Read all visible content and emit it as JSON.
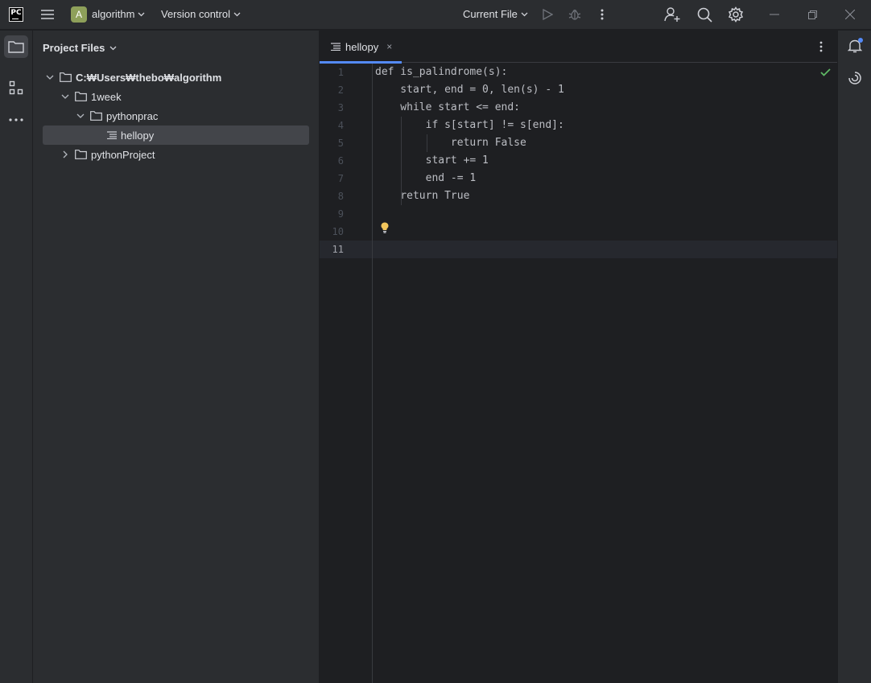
{
  "titlebar": {
    "app_logo_text": "PC",
    "main_menu_icon": "hamburger-icon",
    "project_initial": "A",
    "project_name": "algorithm",
    "vcs_label": "Version control",
    "run_config": "Current File",
    "icons": [
      "run-icon",
      "debug-icon",
      "more-vertical-icon",
      "add-user-icon",
      "search-icon",
      "gear-icon",
      "minimize-icon",
      "restore-icon",
      "close-icon"
    ]
  },
  "toolstrip": {
    "icons": [
      "folder-icon",
      "structure-icon",
      "more-horizontal-icon"
    ]
  },
  "project_panel": {
    "title": "Project Files",
    "tree": [
      {
        "label": "C:₩Users₩thebo₩algorithm",
        "expanded": true
      },
      {
        "label": "1week",
        "expanded": true
      },
      {
        "label": "pythonprac",
        "expanded": true
      },
      {
        "label": "hellopy",
        "selected": true
      },
      {
        "label": "pythonProject",
        "expanded": false
      }
    ]
  },
  "editor": {
    "tab_label": "hellopy",
    "tab_close": "×",
    "lines": [
      {
        "num": "1",
        "text": "def is_palindrome(s):"
      },
      {
        "num": "2",
        "text": "    start, end = 0, len(s) - 1"
      },
      {
        "num": "3",
        "text": "    while start <= end:"
      },
      {
        "num": "4",
        "text": "        if s[start] != s[end]:"
      },
      {
        "num": "5",
        "text": "            return False"
      },
      {
        "num": "6",
        "text": "        start += 1"
      },
      {
        "num": "7",
        "text": "        end -= 1"
      },
      {
        "num": "8",
        "text": "    return True"
      },
      {
        "num": "9",
        "text": ""
      },
      {
        "num": "10",
        "text": ""
      },
      {
        "num": "11",
        "text": ""
      }
    ],
    "current_line": "11"
  },
  "right_strip": {
    "icons": [
      "notifications-icon",
      "ai-assistant-icon"
    ]
  },
  "colors": {
    "accent": "#548af7",
    "ok_check": "#5fb865",
    "bulb": "#f2c55c",
    "project_avatar": "#8ea05a"
  }
}
